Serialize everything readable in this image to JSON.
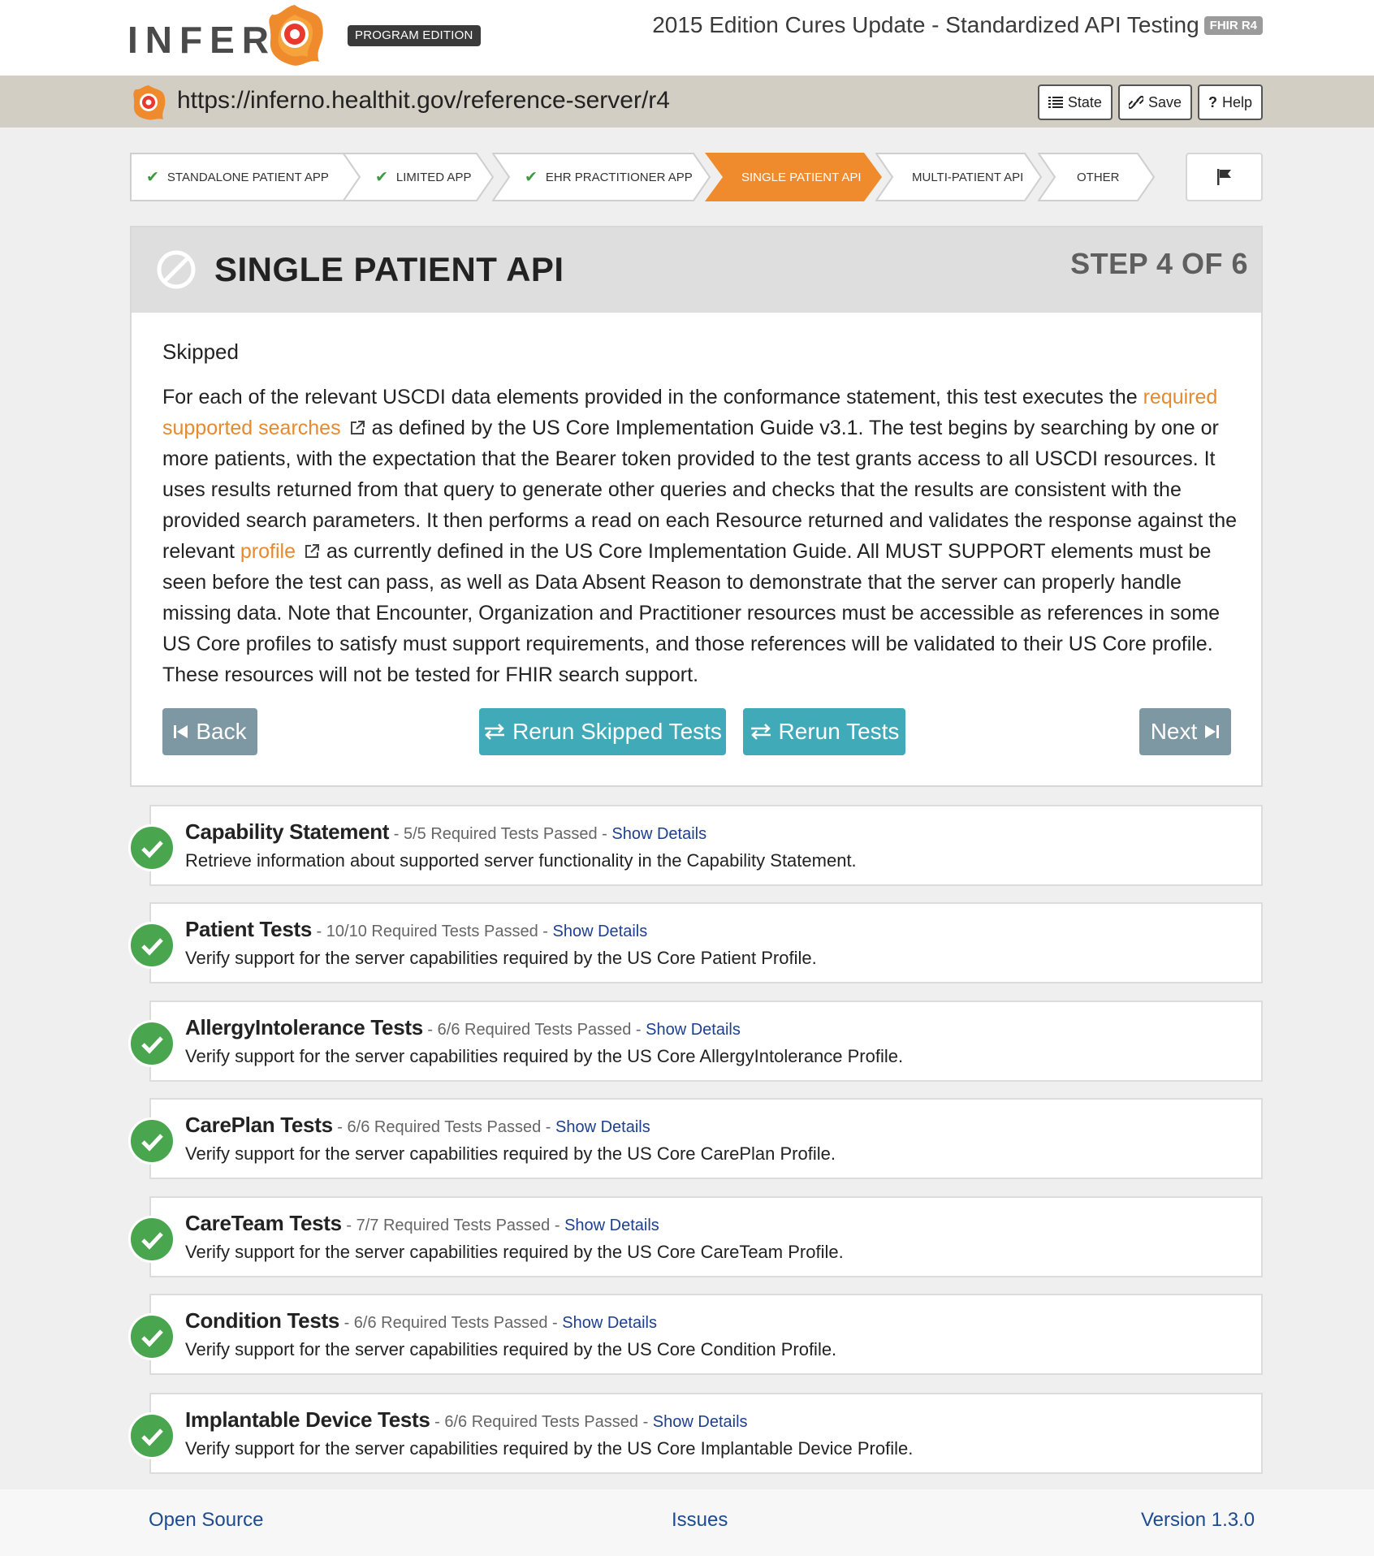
{
  "header": {
    "logo_text": "INFERN",
    "edition_badge": "PROGRAM EDITION",
    "title": "2015 Edition Cures Update - Standardized API Testing",
    "fhir_badge": "FHIR R4"
  },
  "urlbar": {
    "url": "https://inferno.healthit.gov/reference-server/r4",
    "buttons": {
      "state": "State",
      "save": "Save",
      "help": "Help"
    }
  },
  "steps": [
    {
      "label": "STANDALONE PATIENT APP",
      "complete": true
    },
    {
      "label": "LIMITED APP",
      "complete": true
    },
    {
      "label": "EHR PRACTITIONER APP",
      "complete": true
    },
    {
      "label": "SINGLE PATIENT API",
      "active": true
    },
    {
      "label": "MULTI-PATIENT API"
    },
    {
      "label": "OTHER"
    }
  ],
  "panel": {
    "title": "SINGLE PATIENT API",
    "step_indicator": "STEP 4 OF 6",
    "status": "Skipped",
    "desc_p1": "For each of the relevant USCDI data elements provided in the conformance statement, this test executes the ",
    "desc_link1": "required supported searches",
    "desc_p2": "as defined by the US Core Implementation Guide v3.1. The test begins by searching by one or more patients, with the expectation that the Bearer token provided to the test grants access to all USCDI resources. It uses results returned from that query to generate other queries and checks that the results are consistent with the provided search parameters. It then performs a read on each Resource returned and validates the response against the relevant ",
    "desc_link2": "profile",
    "desc_p3": "as currently defined in the US Core Implementation Guide. All MUST SUPPORT elements must be seen before the test can pass, as well as Data Absent Reason to demonstrate that the server can properly handle missing data. Note that Encounter, Organization and Practitioner resources must be accessible as references in some US Core profiles to satisfy must support requirements, and those references will be validated to their US Core profile. These resources will not be tested for FHIR search support.",
    "buttons": {
      "back": "Back",
      "rerun_skipped": "Rerun Skipped Tests",
      "rerun": "Rerun Tests",
      "next": "Next"
    }
  },
  "groups": [
    {
      "title": "Capability Statement",
      "meta": "5/5 Required Tests Passed",
      "link": "Show Details",
      "desc": "Retrieve information about supported server functionality in the Capability Statement."
    },
    {
      "title": "Patient Tests",
      "meta": "10/10 Required Tests Passed",
      "link": "Show Details",
      "desc": "Verify support for the server capabilities required by the US Core Patient Profile."
    },
    {
      "title": "AllergyIntolerance Tests",
      "meta": "6/6 Required Tests Passed",
      "link": "Show Details",
      "desc": "Verify support for the server capabilities required by the US Core AllergyIntolerance Profile."
    },
    {
      "title": "CarePlan Tests",
      "meta": "6/6 Required Tests Passed",
      "link": "Show Details",
      "desc": "Verify support for the server capabilities required by the US Core CarePlan Profile."
    },
    {
      "title": "CareTeam Tests",
      "meta": "7/7 Required Tests Passed",
      "link": "Show Details",
      "desc": "Verify support for the server capabilities required by the US Core CareTeam Profile."
    },
    {
      "title": "Condition Tests",
      "meta": "6/6 Required Tests Passed",
      "link": "Show Details",
      "desc": "Verify support for the server capabilities required by the US Core Condition Profile."
    },
    {
      "title": "Implantable Device Tests",
      "meta": "6/6 Required Tests Passed",
      "link": "Show Details",
      "desc": "Verify support for the server capabilities required by the US Core Implantable Device Profile."
    }
  ],
  "footer": {
    "open_source": "Open Source",
    "issues": "Issues",
    "version": "Version 1.3.0"
  },
  "colors": {
    "accent_orange": "#ef8b2c",
    "pass_green": "#4aa54f",
    "teal_button": "#40aab8",
    "grey_button": "#7d98a3",
    "link_blue": "#1d3f8e"
  }
}
